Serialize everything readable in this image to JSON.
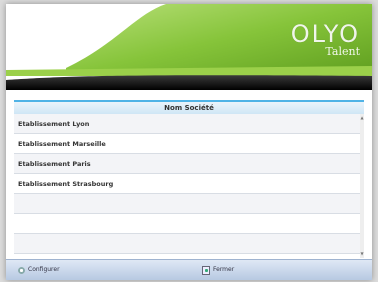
{
  "header": {
    "logo_main": "OLYO",
    "logo_sub": "Talent"
  },
  "table": {
    "column_header": "Nom Société",
    "rows": [
      "Etablissement Lyon",
      "Etablissement Marseille",
      "Etablissement Paris",
      "Etablissement Strasbourg",
      "",
      "",
      ""
    ]
  },
  "footer": {
    "configurer_label": "Configurer",
    "fermer_label": "Fermer"
  },
  "colors": {
    "brand_green": "#7bbf2a",
    "accent_blue": "#4fb3e6",
    "dark_band": "#1a1a1a"
  }
}
